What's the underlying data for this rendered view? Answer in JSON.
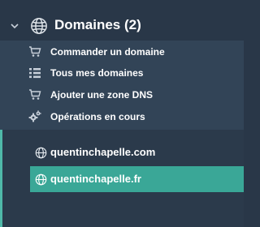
{
  "section": {
    "title": "Domaines (2)",
    "icon": "globe-icon",
    "expanded": true
  },
  "menu": {
    "items": [
      {
        "label": "Commander un domaine",
        "icon": "cart-icon"
      },
      {
        "label": "Tous mes domaines",
        "icon": "list-icon"
      },
      {
        "label": "Ajouter une zone DNS",
        "icon": "cart-icon"
      },
      {
        "label": "Opérations en cours",
        "icon": "gears-icon"
      }
    ]
  },
  "domains": {
    "items": [
      {
        "name": "quentinchapelle.com",
        "icon": "globe-icon",
        "active": false
      },
      {
        "name": "quentinchapelle.fr",
        "icon": "globe-icon",
        "active": true
      }
    ]
  },
  "colors": {
    "background": "#293748",
    "submenu_background": "#324457",
    "active": "#3aa797",
    "accent": "#4fb8a8"
  }
}
